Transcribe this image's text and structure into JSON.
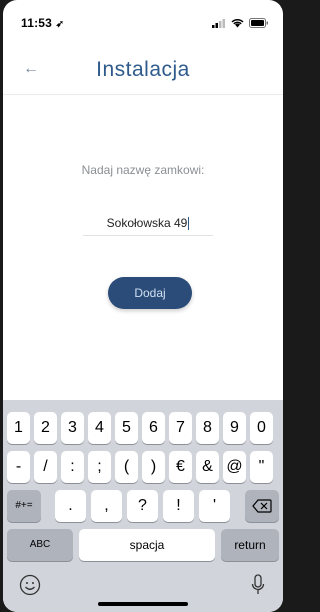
{
  "status": {
    "time": "11:53"
  },
  "nav": {
    "title": "Instalacja"
  },
  "form": {
    "label": "Nadaj nazwę zamkowi:",
    "value": "Sokołowska 49",
    "button": "Dodaj"
  },
  "keyboard": {
    "row1": [
      "1",
      "2",
      "3",
      "4",
      "5",
      "6",
      "7",
      "8",
      "9",
      "0"
    ],
    "row2": [
      "-",
      "/",
      ":",
      ";",
      "(",
      ")",
      "€",
      "&",
      "@",
      "\""
    ],
    "row3_mode": "#+=",
    "row3": [
      ".",
      ",",
      "?",
      "!",
      "'"
    ],
    "abc": "ABC",
    "space": "spacja",
    "return": "return"
  }
}
